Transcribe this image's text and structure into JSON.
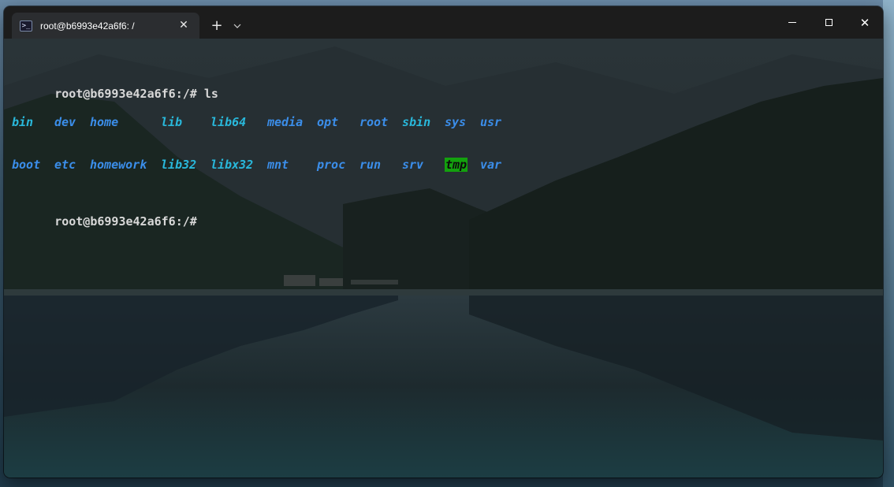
{
  "window": {
    "tab_title": "root@b6993e42a6f6: /",
    "tab_icon": "powershell-terminal-icon",
    "new_tab_label": "+",
    "dropdown_label": "⌵",
    "close_tab_label": "✕",
    "controls": {
      "minimize": "minimize-icon",
      "maximize": "maximize-icon",
      "close": "✕"
    }
  },
  "terminal": {
    "prompt": "root@b6993e42a6f6:/#",
    "command": "ls",
    "ls_rows": [
      [
        {
          "name": "bin",
          "kind": "link"
        },
        {
          "name": "dev",
          "kind": "dir"
        },
        {
          "name": "home",
          "kind": "dir"
        },
        {
          "name": "lib",
          "kind": "link"
        },
        {
          "name": "lib64",
          "kind": "link"
        },
        {
          "name": "media",
          "kind": "dir"
        },
        {
          "name": "opt",
          "kind": "dir"
        },
        {
          "name": "root",
          "kind": "dir"
        },
        {
          "name": "sbin",
          "kind": "link"
        },
        {
          "name": "sys",
          "kind": "dir"
        },
        {
          "name": "usr",
          "kind": "dir"
        }
      ],
      [
        {
          "name": "boot",
          "kind": "dir"
        },
        {
          "name": "etc",
          "kind": "dir"
        },
        {
          "name": "homework",
          "kind": "dir"
        },
        {
          "name": "lib32",
          "kind": "link"
        },
        {
          "name": "libx32",
          "kind": "link"
        },
        {
          "name": "mnt",
          "kind": "dir"
        },
        {
          "name": "proc",
          "kind": "dir"
        },
        {
          "name": "run",
          "kind": "dir"
        },
        {
          "name": "srv",
          "kind": "dir"
        },
        {
          "name": "tmp",
          "kind": "sticky"
        },
        {
          "name": "var",
          "kind": "dir"
        }
      ]
    ],
    "colors": {
      "dir": "#3b8eea",
      "link": "#29b8db",
      "sticky_bg": "#13a10e",
      "text": "#d8d8d8"
    }
  }
}
